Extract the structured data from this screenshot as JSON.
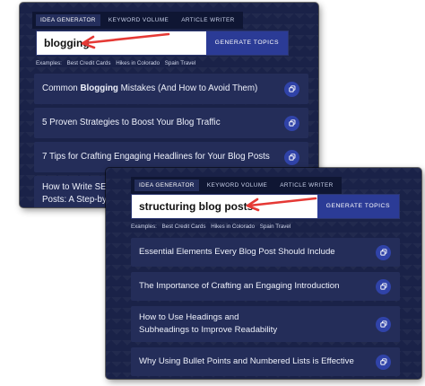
{
  "panel_a": {
    "tabs": [
      "IDEA GENERATOR",
      "KEYWORD VOLUME",
      "ARTICLE WRITER"
    ],
    "search_value": "blogging",
    "generate_label": "GENERATE TOPICS",
    "examples_label": "Examples:",
    "examples": [
      "Best Credit Cards",
      "Hikes in Colorado",
      "Spain Travel"
    ],
    "results": {
      "r1_pre": "Common ",
      "r1_bold": "Blogging",
      "r1_post": " Mistakes (And How to Avoid Them)",
      "r2": "5 Proven Strategies to Boost Your Blog Traffic",
      "r3": "7 Tips for Crafting Engaging Headlines for Your Blog Posts",
      "r4_line1": "How to Write SEO",
      "r4_line2": "Posts: A Step-by-"
    }
  },
  "panel_b": {
    "tabs": [
      "IDEA GENERATOR",
      "KEYWORD VOLUME",
      "ARTICLE WRITER"
    ],
    "search_value": "structuring blog posts",
    "generate_label": "GENERATE TOPICS",
    "examples_label": "Examples:",
    "examples": [
      "Best Credit Cards",
      "Hikes in Colorado",
      "Spain Travel"
    ],
    "results": {
      "r1": "Essential Elements Every Blog Post Should Include",
      "r2": "The Importance of Crafting an Engaging Introduction",
      "r3_line1": "How to Use Headings and",
      "r3_line2": "Subheadings to Improve Readability",
      "r4": "Why Using Bullet Points and Numbered Lists is Effective"
    }
  },
  "icons": {
    "copy": "copy-icon",
    "annotation": "red-arrow"
  },
  "colors": {
    "panel_bg": "#1a2248",
    "result_bg": "#242d59",
    "button_bg": "#2b3b96",
    "copy_bg": "#3043a8",
    "arrow": "#e53935"
  }
}
